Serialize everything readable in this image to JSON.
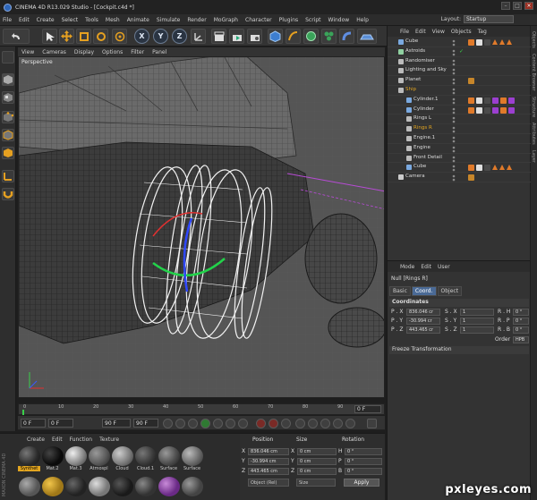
{
  "window": {
    "title": "CINEMA 4D R13.029 Studio - [Cockpit.c4d *]"
  },
  "menu": {
    "items": [
      "File",
      "Edit",
      "Create",
      "Select",
      "Tools",
      "Mesh",
      "Animate",
      "Simulate",
      "Render",
      "MoGraph",
      "Character",
      "Plugins",
      "Script",
      "Window",
      "Help"
    ],
    "layout_label": "Layout:",
    "layout_value": "Startup"
  },
  "toolbar": {
    "x_axis": "X",
    "y_axis": "Y",
    "z_axis": "Z"
  },
  "viewport": {
    "menu": [
      "View",
      "Cameras",
      "Display",
      "Options",
      "Filter",
      "Panel"
    ],
    "label": "Perspective"
  },
  "timeline": {
    "ticks": [
      "0",
      "10",
      "20",
      "30",
      "40",
      "50",
      "60",
      "70",
      "80",
      "90"
    ],
    "frame": "0 F",
    "start_frame": "0 F",
    "min_frame": "0 F",
    "max_frame": "90 F",
    "end_frame": "90 F"
  },
  "materials": {
    "menu": [
      "Create",
      "Edit",
      "Function",
      "Texture"
    ],
    "logo_text": "MAXON CINEMA 4D",
    "items": [
      {
        "name": "Synthet",
        "color": "#2a2a2a",
        "selected": true
      },
      {
        "name": "Mat.2",
        "color": "#0a0a0a",
        "selected": false
      },
      {
        "name": "Mat.3",
        "color": "#8a8a8a",
        "selected": false
      },
      {
        "name": "Atmospl",
        "color": "#5a5a5a",
        "selected": false
      },
      {
        "name": "Cloud",
        "color": "#7c7c7c",
        "selected": false
      },
      {
        "name": "Cloud.1",
        "color": "#3a3a3a",
        "selected": false
      },
      {
        "name": "Surface",
        "color": "#4e4e4e",
        "selected": false
      },
      {
        "name": "Surface",
        "color": "#6a6a6a",
        "selected": false
      }
    ]
  },
  "coordinates": {
    "headers": [
      "Position",
      "Size",
      "Rotation"
    ],
    "rows": [
      {
        "axis": "X",
        "pos": "836.046 cm",
        "size": "0 cm",
        "rot_label": "H",
        "rot": "0 °"
      },
      {
        "axis": "Y",
        "pos": "-30.994 cm",
        "size": "0 cm",
        "rot_label": "P",
        "rot": "0 °"
      },
      {
        "axis": "Z",
        "pos": "443.465 cm",
        "size": "0 cm",
        "rot_label": "B",
        "rot": "0 °"
      }
    ],
    "mode_select": "Object (Rel)",
    "size_select": "Size",
    "apply": "Apply"
  },
  "object_manager": {
    "menu": [
      "File",
      "Edit",
      "View",
      "Objects",
      "Tag"
    ],
    "objects": [
      {
        "name": "Cube",
        "indent": 0,
        "color": "#7aa9e0",
        "highlight": false
      },
      {
        "name": "Astroids",
        "indent": 0,
        "color": "#8fd0a0",
        "highlight": false
      },
      {
        "name": "Randomiser",
        "indent": 0,
        "color": "#bbbbbb",
        "highlight": false
      },
      {
        "name": "Lighting and Sky",
        "indent": 0,
        "color": "#bbbbbb",
        "highlight": false
      },
      {
        "name": "Planet",
        "indent": 0,
        "color": "#bbbbbb",
        "highlight": false
      },
      {
        "name": "Ship",
        "indent": 0,
        "color": "#bbbbbb",
        "highlight": true
      },
      {
        "name": "Cylinder.1",
        "indent": 1,
        "color": "#7aa9e0",
        "highlight": false
      },
      {
        "name": "Cylinder",
        "indent": 1,
        "color": "#7aa9e0",
        "highlight": false
      },
      {
        "name": "Rings L",
        "indent": 1,
        "color": "#bbbbbb",
        "highlight": false
      },
      {
        "name": "Rings R",
        "indent": 1,
        "color": "#bbbbbb",
        "highlight": true
      },
      {
        "name": "Engine.1",
        "indent": 1,
        "color": "#bbbbbb",
        "highlight": false
      },
      {
        "name": "Engine",
        "indent": 1,
        "color": "#bbbbbb",
        "highlight": false
      },
      {
        "name": "Front Detail",
        "indent": 1,
        "color": "#bbbbbb",
        "highlight": false
      },
      {
        "name": "Cube",
        "indent": 1,
        "color": "#7aa9e0",
        "highlight": false
      },
      {
        "name": "Camera",
        "indent": 0,
        "color": "#cccccc",
        "highlight": false
      }
    ]
  },
  "attributes": {
    "menu": [
      "Mode",
      "Edit",
      "User"
    ],
    "object": "Null [Rings R]",
    "tabs": [
      "Basic",
      "Coord.",
      "Object"
    ],
    "active_tab": "Coord.",
    "section": "Coordinates",
    "rows": [
      {
        "p": "P . X",
        "pv": "836.046 cr",
        "s": "S . X",
        "sv": "1",
        "r": "R . H",
        "rv": "0 °"
      },
      {
        "p": "P . Y",
        "pv": "-30.994 cr",
        "s": "S . Y",
        "sv": "1",
        "r": "R . P",
        "rv": "0 °"
      },
      {
        "p": "P . Z",
        "pv": "443.465 cr",
        "s": "S . Z",
        "sv": "1",
        "r": "R . B",
        "rv": "0 °"
      }
    ],
    "order_label": "Order",
    "order_value": "HPB",
    "freeze": "Freeze Transformation"
  },
  "side_tabs": [
    "Objects",
    "Content Browser",
    "Structure",
    "Attributes",
    "Layer"
  ],
  "watermark": "pxleyes.com",
  "colors": {
    "accent_orange": "#e2a520",
    "active_tab_blue": "#4a6a96",
    "viewport_bg": "#505050"
  }
}
